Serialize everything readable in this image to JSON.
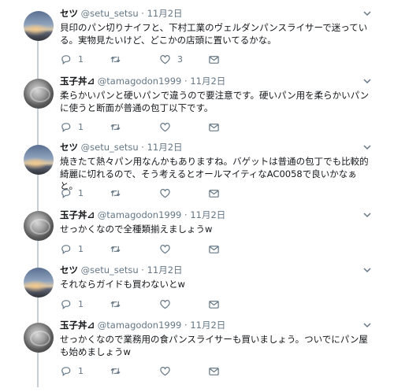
{
  "tweets": [
    {
      "name": "セツ",
      "handle": "@setu_setsu",
      "sep": "·",
      "date": "11月2日",
      "text": "貝印のパン切りナイフと、下村工業のヴェルダンパンスライサーで迷っている。実物見たいけど、どこかの店頭に置いてるかな。",
      "reply_count": "1",
      "retweet_count": "",
      "like_count": "3"
    },
    {
      "name": "玉子丼⊿",
      "handle": "@tamagodon1999",
      "sep": "·",
      "date": "11月2日",
      "text": "柔らかいパンと硬いパンで違うので要注意です。硬いパン用を柔らかいパンに使うと断面が普通の包丁以下です。",
      "reply_count": "1",
      "retweet_count": "",
      "like_count": ""
    },
    {
      "name": "セツ",
      "handle": "@setu_setsu",
      "sep": "·",
      "date": "11月2日",
      "text": "焼きたて熱々パン用なんかもありますね。バゲットは普通の包丁でも比較的綺麗に切れるので、そう考えるとオールマイティなAC0058で良いかなぁと。",
      "reply_count": "1",
      "retweet_count": "",
      "like_count": ""
    },
    {
      "name": "玉子丼⊿",
      "handle": "@tamagodon1999",
      "sep": "·",
      "date": "11月2日",
      "text": "せっかくなので全種類揃えましょうw",
      "reply_count": "1",
      "retweet_count": "",
      "like_count": ""
    },
    {
      "name": "セツ",
      "handle": "@setu_setsu",
      "sep": "·",
      "date": "11月2日",
      "text": "それならガイドも買わないとw",
      "reply_count": "1",
      "retweet_count": "",
      "like_count": ""
    },
    {
      "name": "玉子丼⊿",
      "handle": "@tamagodon1999",
      "sep": "·",
      "date": "11月2日",
      "text": "せっかくなので業務用の食パンスライサーも買いましょう。ついでにパン屋も始めましょうw",
      "reply_count": "1",
      "retweet_count": "",
      "like_count": ""
    }
  ],
  "icons": {
    "reply": "reply-icon",
    "retweet": "retweet-icon",
    "like": "heart-icon",
    "dm": "envelope-icon",
    "more": "chevron-down-icon"
  },
  "colors": {
    "text": "#14171a",
    "muted": "#657786",
    "thread_line": "#c4cfd6",
    "background": "#ffffff"
  }
}
